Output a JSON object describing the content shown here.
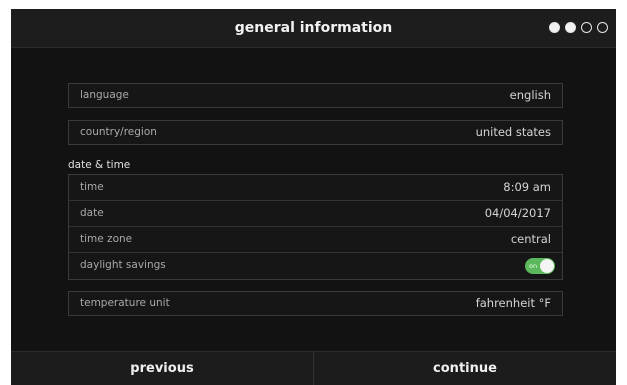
{
  "header": {
    "title": "general information",
    "progress": {
      "total": 4,
      "filled": 2
    }
  },
  "fields": {
    "language": {
      "label": "language",
      "value": "english"
    },
    "country": {
      "label": "country/region",
      "value": "united states"
    },
    "date_time_section": "date & time",
    "time": {
      "label": "time",
      "value": "8:09 am"
    },
    "date": {
      "label": "date",
      "value": "04/04/2017"
    },
    "time_zone": {
      "label": "time zone",
      "value": "central"
    },
    "daylight": {
      "label": "daylight savings",
      "toggle_text": "on",
      "state": true
    },
    "temperature": {
      "label": "temperature unit",
      "value": "fahrenheit °F"
    }
  },
  "footer": {
    "previous_label": "previous",
    "continue_label": "continue"
  },
  "colors": {
    "toggle_on": "#5cb85c",
    "background": "#121212"
  },
  "icons": [
    "step-dot-filled",
    "step-dot-empty"
  ]
}
